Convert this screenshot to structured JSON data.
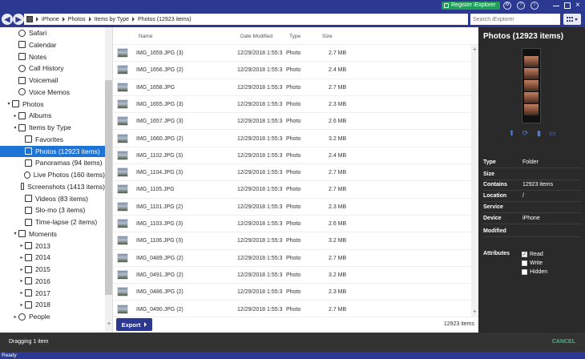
{
  "topbar": {
    "register_label": "Register iExplorer",
    "icons": [
      "settings-icon",
      "help-icon",
      "info-icon"
    ]
  },
  "nav": {
    "breadcrumb": [
      "iPhone",
      "Photos",
      "Items by Type",
      "Photos (12923 items)"
    ],
    "search_placeholder": "Search iExplorer"
  },
  "sidebar": {
    "items": [
      {
        "label": "Safari",
        "icon": "compass-icon",
        "caret": ""
      },
      {
        "label": "Calendar",
        "icon": "calendar-icon",
        "caret": ""
      },
      {
        "label": "Notes",
        "icon": "notes-icon",
        "caret": ""
      },
      {
        "label": "Call History",
        "icon": "phone-icon",
        "caret": ""
      },
      {
        "label": "Voicemail",
        "icon": "voicemail-icon",
        "caret": ""
      },
      {
        "label": "Voice Memos",
        "icon": "microphone-icon",
        "caret": ""
      },
      {
        "label": "Photos",
        "icon": "photos-icon",
        "caret": "▾"
      },
      {
        "label": "Albums",
        "icon": "camera-icon",
        "caret": "▸"
      },
      {
        "label": "Items by Type",
        "icon": "image-icon",
        "caret": "▾"
      },
      {
        "label": "Favorites",
        "icon": "heart-icon",
        "caret": ""
      },
      {
        "label": "Photos (12923 items)",
        "icon": "image-icon",
        "caret": ""
      },
      {
        "label": "Panoramas (94 items)",
        "icon": "panorama-icon",
        "caret": ""
      },
      {
        "label": "Live Photos (160 items)",
        "icon": "live-photo-icon",
        "caret": ""
      },
      {
        "label": "Screenshots (1413 items)",
        "icon": "screenshot-icon",
        "caret": ""
      },
      {
        "label": "Videos (83 items)",
        "icon": "video-icon",
        "caret": ""
      },
      {
        "label": "Slo-mo (3 items)",
        "icon": "slomo-icon",
        "caret": ""
      },
      {
        "label": "Time-lapse (2 items)",
        "icon": "timelapse-icon",
        "caret": ""
      },
      {
        "label": "Moments",
        "icon": "calendar-icon",
        "caret": "▾"
      },
      {
        "label": "2013",
        "icon": "calendar-icon",
        "caret": "▸"
      },
      {
        "label": "2014",
        "icon": "calendar-icon",
        "caret": "▸"
      },
      {
        "label": "2015",
        "icon": "calendar-icon",
        "caret": "▸"
      },
      {
        "label": "2016",
        "icon": "calendar-icon",
        "caret": "▸"
      },
      {
        "label": "2017",
        "icon": "calendar-icon",
        "caret": "▸"
      },
      {
        "label": "2018",
        "icon": "calendar-icon",
        "caret": "▸"
      },
      {
        "label": "People",
        "icon": "people-icon",
        "caret": "▸"
      }
    ]
  },
  "list": {
    "columns": {
      "name": "Name",
      "date": "Date Modified",
      "type": "Type",
      "size": "Size"
    },
    "rows": [
      {
        "name": "IMG_1659.JPG (3)",
        "date": "12/29/2018 1:55:3",
        "type": "Photo",
        "size": "2.7 MB"
      },
      {
        "name": "IMG_1656.JPG (2)",
        "date": "12/29/2018 1:55:3",
        "type": "Photo",
        "size": "2.4 MB"
      },
      {
        "name": "IMG_1658.JPG",
        "date": "12/29/2018 1:55:3",
        "type": "Photo",
        "size": "2.7 MB"
      },
      {
        "name": "IMG_1655.JPG (3)",
        "date": "12/29/2018 1:55:3",
        "type": "Photo",
        "size": "2.3 MB"
      },
      {
        "name": "IMG_1657.JPG (3)",
        "date": "12/29/2018 1:55:3",
        "type": "Photo",
        "size": "2.6 MB"
      },
      {
        "name": "IMG_1660.JPG (2)",
        "date": "12/29/2018 1:55:3",
        "type": "Photo",
        "size": "3.2 MB"
      },
      {
        "name": "IMG_1102.JPG (3)",
        "date": "12/29/2018 1:55:3",
        "type": "Photo",
        "size": "2.4 MB"
      },
      {
        "name": "IMG_1104.JPG (3)",
        "date": "12/29/2018 1:55:3",
        "type": "Photo",
        "size": "2.7 MB"
      },
      {
        "name": "IMG_1105.JPG",
        "date": "12/29/2018 1:55:3",
        "type": "Photo",
        "size": "2.7 MB"
      },
      {
        "name": "IMG_1101.JPG (2)",
        "date": "12/29/2018 1:55:3",
        "type": "Photo",
        "size": "2.3 MB"
      },
      {
        "name": "IMG_1103.JPG (3)",
        "date": "12/29/2018 1:55:3",
        "type": "Photo",
        "size": "2.6 MB"
      },
      {
        "name": "IMG_1106.JPG (3)",
        "date": "12/29/2018 1:55:3",
        "type": "Photo",
        "size": "3.2 MB"
      },
      {
        "name": "IMG_0489.JPG (2)",
        "date": "12/29/2018 1:55:3",
        "type": "Photo",
        "size": "2.7 MB"
      },
      {
        "name": "IMG_0491.JPG (2)",
        "date": "12/29/2018 1:55:3",
        "type": "Photo",
        "size": "3.2 MB"
      },
      {
        "name": "IMG_0486.JPG (2)",
        "date": "12/29/2018 1:55:3",
        "type": "Photo",
        "size": "2.3 MB"
      },
      {
        "name": "IMG_0490.JPG (2)",
        "date": "12/29/2018 1:55:3",
        "type": "Photo",
        "size": "2.7 MB"
      }
    ],
    "export_label": "Export",
    "item_count": "12923 items"
  },
  "panel": {
    "title": "Photos (12923 items)",
    "props": [
      {
        "key": "Type",
        "value": "Folder"
      },
      {
        "key": "Size",
        "value": ""
      },
      {
        "key": "Contains",
        "value": "12923 items"
      },
      {
        "key": "Location",
        "value": "/"
      },
      {
        "key": "Service",
        "value": ""
      },
      {
        "key": "Device",
        "value": "iPhone"
      },
      {
        "key": "Modified",
        "value": ""
      }
    ],
    "attributes_label": "Attributes",
    "attributes": [
      {
        "label": "Read",
        "checked": true
      },
      {
        "label": "Write",
        "checked": false
      },
      {
        "label": "Hidden",
        "checked": false
      }
    ]
  },
  "dragbar": {
    "text": "Dragging 1 item",
    "cancel_label": "CANCEL"
  },
  "status": {
    "text": "Ready"
  }
}
